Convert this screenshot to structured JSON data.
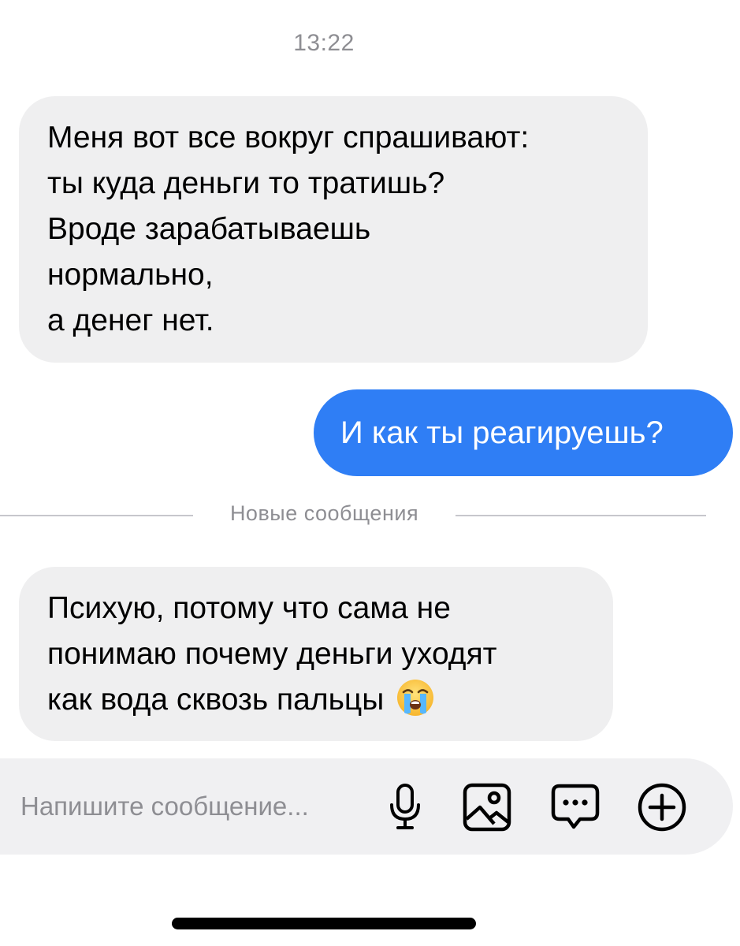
{
  "chat": {
    "timestamp": "13:22",
    "messages": [
      {
        "direction": "incoming",
        "lines": [
          "Меня вот все вокруг спрашивают:",
          "ты куда деньги то тратишь?",
          "Вроде зарабатываешь",
          "нормально,",
          "а денег нет."
        ]
      },
      {
        "direction": "outgoing",
        "lines": [
          "И как ты реагируешь?"
        ]
      },
      {
        "direction": "incoming",
        "lines": [
          "Психую, потому что сама не",
          "понимаю почему деньги уходят",
          "как вода сквозь пальцы"
        ],
        "emoji": "loudly-crying-face"
      }
    ],
    "new_messages_divider": "Новые сообщения"
  },
  "composer": {
    "placeholder": "Напишите сообщение...",
    "tools": [
      "microphone-icon",
      "image-icon",
      "chat-bubble-icon",
      "plus-circle-icon"
    ]
  },
  "colors": {
    "incoming_bubble": "#efeff0",
    "outgoing_bubble": "#2f7ef5",
    "secondary_text": "#8e8e93"
  }
}
